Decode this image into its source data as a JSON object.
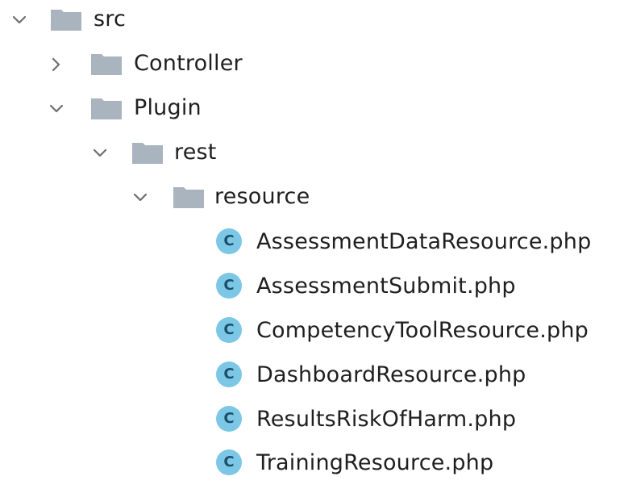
{
  "tree": {
    "src": {
      "label": "src",
      "icon": "folder-icon",
      "expanded": true
    },
    "controller": {
      "label": "Controller",
      "icon": "folder-icon",
      "expanded": false
    },
    "plugin": {
      "label": "Plugin",
      "icon": "folder-icon",
      "expanded": true
    },
    "rest": {
      "label": "rest",
      "icon": "folder-icon",
      "expanded": true
    },
    "resource": {
      "label": "resource",
      "icon": "folder-icon",
      "expanded": true
    },
    "files": [
      {
        "label": "AssessmentDataResource.php",
        "badge": "C",
        "icon": "php-class-icon"
      },
      {
        "label": "AssessmentSubmit.php",
        "badge": "C",
        "icon": "php-class-icon"
      },
      {
        "label": "CompetencyToolResource.php",
        "badge": "C",
        "icon": "php-class-icon"
      },
      {
        "label": "DashboardResource.php",
        "badge": "C",
        "icon": "php-class-icon"
      },
      {
        "label": "ResultsRiskOfHarm.php",
        "badge": "C",
        "icon": "php-class-icon"
      },
      {
        "label": "TrainingResource.php",
        "badge": "C",
        "icon": "php-class-icon"
      }
    ]
  },
  "colors": {
    "folder": "#a9b4bf",
    "class_badge_bg": "#7cc7e6",
    "class_badge_fg": "#1c4f6a",
    "chevron": "#6e6e73",
    "text": "#1f1f1f"
  }
}
